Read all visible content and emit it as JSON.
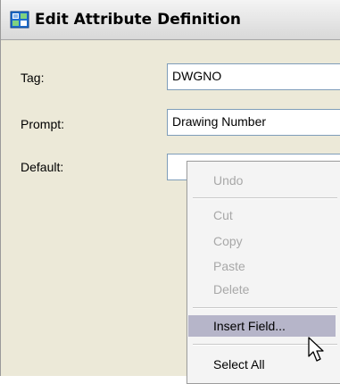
{
  "window": {
    "title": "Edit Attribute Definition"
  },
  "fields": {
    "tag": {
      "label": "Tag:",
      "value": "DWGNO"
    },
    "prompt": {
      "label": "Prompt:",
      "value": "Drawing Number"
    },
    "default": {
      "label": "Default:",
      "value": ""
    }
  },
  "context_menu": {
    "items": [
      {
        "label": "Undo",
        "enabled": false
      },
      {
        "label": "Cut",
        "enabled": false
      },
      {
        "label": "Copy",
        "enabled": false
      },
      {
        "label": "Paste",
        "enabled": false
      },
      {
        "label": "Delete",
        "enabled": false
      },
      {
        "label": "Insert Field...",
        "enabled": true,
        "highlighted": true
      },
      {
        "label": "Select All",
        "enabled": true
      }
    ]
  },
  "colors": {
    "dialog_bg": "#ece9d8",
    "menu_highlight": "#b6b5c9",
    "disabled_text": "#a8a8a8",
    "input_border": "#7f9db9"
  },
  "icons": {
    "title": "attribute-definition-icon",
    "cursor": "mouse-pointer-icon"
  }
}
